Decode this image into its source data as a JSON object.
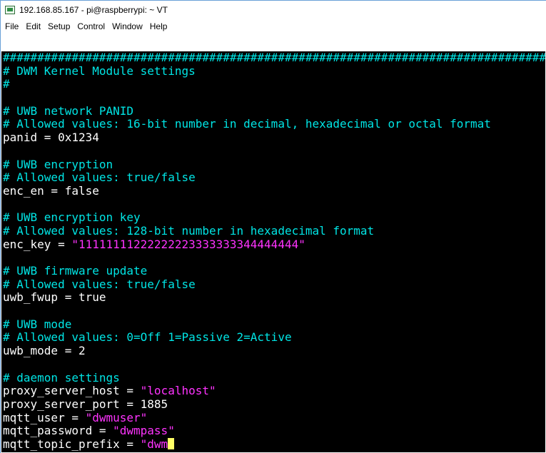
{
  "window": {
    "title": "192.168.85.167 - pi@raspberrypi: ~ VT",
    "icon": "terminal-window-icon"
  },
  "menu": {
    "items": [
      "File",
      "Edit",
      "Setup",
      "Control",
      "Window",
      "Help"
    ]
  },
  "terminal": {
    "colors": {
      "background": "#000000",
      "comment": "#00e5e5",
      "text": "#ffffff",
      "string": "#ff33ff",
      "cursor": "#ffff66"
    },
    "lines": [
      {
        "type": "comment",
        "text": "################################################################################"
      },
      {
        "type": "comment",
        "text": "# DWM Kernel Module settings"
      },
      {
        "type": "comment",
        "text": "#"
      },
      {
        "type": "blank",
        "text": ""
      },
      {
        "type": "comment",
        "text": "# UWB network PANID"
      },
      {
        "type": "comment",
        "text": "# Allowed values: 16-bit number in decimal, hexadecimal or octal format"
      },
      {
        "type": "setting",
        "text": "panid = 0x1234"
      },
      {
        "type": "blank",
        "text": ""
      },
      {
        "type": "comment",
        "text": "# UWB encryption"
      },
      {
        "type": "comment",
        "text": "# Allowed values: true/false"
      },
      {
        "type": "setting",
        "text": "enc_en = false"
      },
      {
        "type": "blank",
        "text": ""
      },
      {
        "type": "comment",
        "text": "# UWB encryption key"
      },
      {
        "type": "comment",
        "text": "# Allowed values: 128-bit number in hexadecimal format"
      },
      {
        "type": "setting",
        "text": "enc_key = ",
        "value": "\"11111111222222223333333344444444\""
      },
      {
        "type": "blank",
        "text": ""
      },
      {
        "type": "comment",
        "text": "# UWB firmware update"
      },
      {
        "type": "comment",
        "text": "# Allowed values: true/false"
      },
      {
        "type": "setting",
        "text": "uwb_fwup = true"
      },
      {
        "type": "blank",
        "text": ""
      },
      {
        "type": "comment",
        "text": "# UWB mode"
      },
      {
        "type": "comment",
        "text": "# Allowed values: 0=Off 1=Passive 2=Active"
      },
      {
        "type": "setting",
        "text": "uwb_mode = 2"
      },
      {
        "type": "blank",
        "text": ""
      },
      {
        "type": "comment",
        "text": "# daemon settings"
      },
      {
        "type": "setting",
        "text": "proxy_server_host = ",
        "value": "\"localhost\""
      },
      {
        "type": "setting",
        "text": "proxy_server_port = 1885"
      },
      {
        "type": "setting",
        "text": "mqtt_user = ",
        "value": "\"dwmuser\""
      },
      {
        "type": "setting",
        "text": "mqtt_password = ",
        "value": "\"dwmpass\""
      },
      {
        "type": "setting",
        "text": "mqtt_topic_prefix = ",
        "value": "\"dwm",
        "cursor": true
      }
    ]
  }
}
